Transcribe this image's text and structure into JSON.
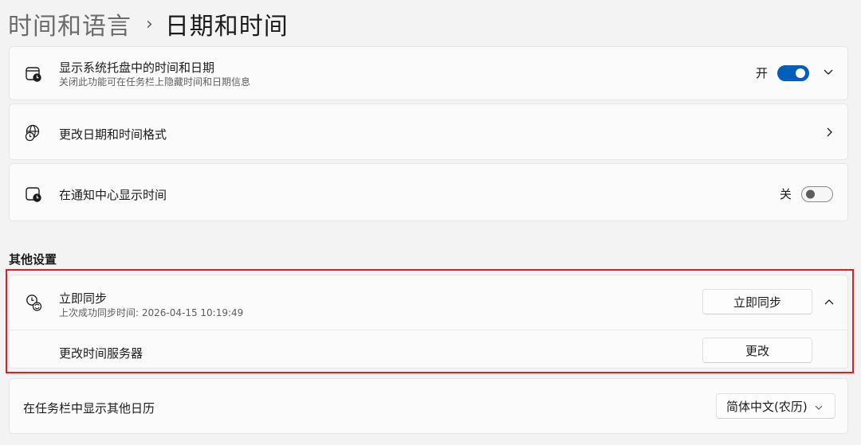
{
  "breadcrumb": {
    "parent": "时间和语言",
    "separator": "›",
    "current": "日期和时间"
  },
  "tray_time": {
    "icon": "calendar-clock-icon",
    "title": "显示系统托盘中的时间和日期",
    "subtitle": "关闭此功能可在任务栏上隐藏时间和日期信息",
    "toggle_label": "开",
    "toggle_on": true
  },
  "format": {
    "icon": "globe-clock-icon",
    "title": "更改日期和时间格式"
  },
  "notification_time": {
    "icon": "calendar-clock-icon",
    "title": "在通知中心显示时间",
    "toggle_label": "关",
    "toggle_on": false
  },
  "other_settings": {
    "heading": "其他设置"
  },
  "sync": {
    "icon": "clock-sync-icon",
    "title": "立即同步",
    "subtitle": "上次成功同步时间: 2026-04-15 10:19:49",
    "button_label": "立即同步",
    "time_server_label": "更改时间服务器",
    "change_button_label": "更改"
  },
  "calendar": {
    "title": "在任务栏中显示其他日历",
    "selected": "简体中文(农历)"
  },
  "colors": {
    "accent": "#005fb8",
    "highlight": "#e02020"
  }
}
